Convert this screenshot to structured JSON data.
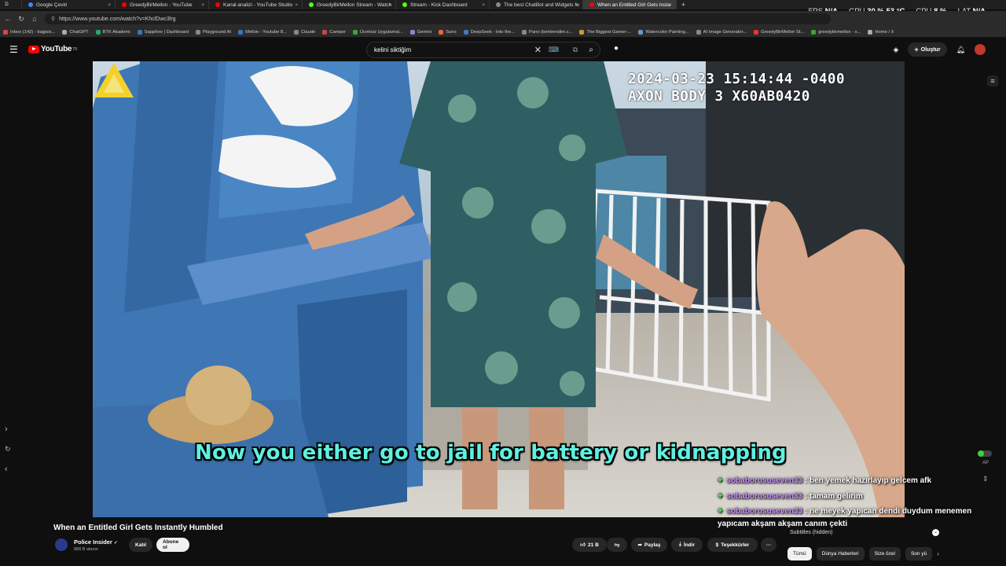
{
  "browser": {
    "tabs": [
      {
        "title": "Google Çeviri",
        "color": "#4285f4",
        "active": false
      },
      {
        "title": "GreedyBirMellon - YouTube",
        "color": "#ff0000",
        "active": false
      },
      {
        "title": "Kanal analizi - YouTube Studio",
        "color": "#ff0000",
        "active": false
      },
      {
        "title": "GreedyBirMellon Stream - Watch",
        "color": "#53fc18",
        "active": false
      },
      {
        "title": "Stream - Kick Dashboard",
        "color": "#53fc18",
        "active": false
      },
      {
        "title": "The best ChatBot and Widgets fo",
        "color": "#888888",
        "active": false
      },
      {
        "title": "When an Entitled Girl Gets Insta",
        "color": "#ff0000",
        "active": true
      }
    ],
    "url": "https://www.youtube.com/watch?v=KhclDwc3lrg",
    "stats": {
      "fps_label": "FPS",
      "fps": "N/A",
      "gpu_label": "GPU",
      "gpu": "30 %",
      "gpu_temp": "53 °C",
      "cpu_label": "CPU",
      "cpu": "8 %",
      "lat_label": "LAT",
      "lat": "N/A"
    },
    "bookmarks": [
      {
        "label": "Inbox (142) - bagisis...",
        "color": "#d44"
      },
      {
        "label": "ChatGPT",
        "color": "#aaa"
      },
      {
        "label": "BTK Akademi",
        "color": "#2a6"
      },
      {
        "label": "Sapphire | Dashboard",
        "color": "#37c"
      },
      {
        "label": "Playground AI",
        "color": "#888"
      },
      {
        "label": "Mellon - Youtube 8...",
        "color": "#37c"
      },
      {
        "label": "Claude",
        "color": "#888"
      },
      {
        "label": "Camper",
        "color": "#c44"
      },
      {
        "label": "Ücretsiz Uygulamal...",
        "color": "#3a3"
      },
      {
        "label": "Gemini",
        "color": "#88c"
      },
      {
        "label": "Suno",
        "color": "#e63"
      },
      {
        "label": "DeepSeek - Into the...",
        "color": "#47c"
      },
      {
        "label": "Pano (bentrendim.c...",
        "color": "#888"
      },
      {
        "label": "The Biggest Gamer-...",
        "color": "#c93"
      },
      {
        "label": "Watercolor Painting...",
        "color": "#69c"
      },
      {
        "label": "AI Image Generator...",
        "color": "#888"
      },
      {
        "label": "GreedyBirMellon St...",
        "color": "#e33"
      },
      {
        "label": "greedybirmellon - s...",
        "color": "#3a3"
      },
      {
        "label": "Home / X",
        "color": "#aaa"
      }
    ]
  },
  "youtube": {
    "logo_text": "YouTube",
    "logo_region": "TR",
    "search_value": "kelini siktiğim",
    "create_label": "Oluştur"
  },
  "video": {
    "timestamp": "2024-03-23 15:14:44 -0400",
    "camera": "AXON BODY 3 X60AB0420",
    "subtitle": "Now you either go to jail for battery or kidnapping"
  },
  "chat": {
    "messages": [
      {
        "user": "sobaborususeven33",
        "text": ": ben yemek hazırlayıp gelcem afk"
      },
      {
        "user": "sobaborususeven33",
        "text": ": tamam gelirim"
      },
      {
        "user": "sobaborususeven33",
        "text": ": ne meyek yapıcan dendi duydum menemen"
      }
    ],
    "overflow_line": "yapıcam akşam akşam canım çekti",
    "ap_label": "AP"
  },
  "below": {
    "title": "When an Entitled Girl Gets Instantly Humbled",
    "channel": "Police Insider",
    "subs": "888 B abone",
    "join_label": "Katıl",
    "subscribe_label": "Abone ol",
    "likes": "21 B",
    "share_label": "Paylaş",
    "download_label": "İndir",
    "thanks_label": "Teşekkürler",
    "more_label": "···",
    "subtitles_status": "Subtitles (hidden)",
    "chips": [
      "Tümü",
      "Dünya Haberleri",
      "Size özel",
      "Son yü"
    ]
  }
}
